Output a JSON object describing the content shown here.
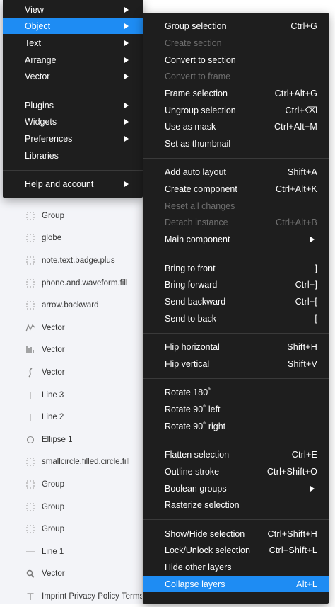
{
  "layers_panel": {
    "rows": [
      {
        "label": "Group",
        "icon": "dashed-frame-icon"
      },
      {
        "label": "globe",
        "icon": "dashed-frame-icon"
      },
      {
        "label": "note.text.badge.plus",
        "icon": "dashed-frame-icon"
      },
      {
        "label": "phone.and.waveform.fill",
        "icon": "dashed-frame-icon"
      },
      {
        "label": "arrow.backward",
        "icon": "dashed-frame-icon"
      },
      {
        "label": "Vector",
        "icon": "vector-wave-icon"
      },
      {
        "label": "Vector",
        "icon": "vector-bars-icon"
      },
      {
        "label": "Vector",
        "icon": "vector-curve-icon"
      },
      {
        "label": "Line 3",
        "icon": "vertical-line-icon"
      },
      {
        "label": "Line 2",
        "icon": "vertical-line-icon"
      },
      {
        "label": "Ellipse 1",
        "icon": "ellipse-icon"
      },
      {
        "label": "smallcircle.filled.circle.fill",
        "icon": "dashed-frame-icon"
      },
      {
        "label": "Group",
        "icon": "dashed-frame-icon"
      },
      {
        "label": "Group",
        "icon": "dashed-frame-icon"
      },
      {
        "label": "Group",
        "icon": "dashed-frame-icon"
      },
      {
        "label": "Line 1",
        "icon": "horizontal-line-icon"
      },
      {
        "label": "Vector",
        "icon": "search-icon"
      },
      {
        "label": "Imprint Privacy Policy Terms",
        "icon": "text-icon"
      }
    ]
  },
  "main_menu": {
    "items": [
      {
        "label": "View",
        "submenu": true
      },
      {
        "label": "Object",
        "submenu": true,
        "active": true
      },
      {
        "label": "Text",
        "submenu": true
      },
      {
        "label": "Arrange",
        "submenu": true
      },
      {
        "label": "Vector",
        "submenu": true
      },
      {
        "label": "Plugins",
        "submenu": true
      },
      {
        "label": "Widgets",
        "submenu": true
      },
      {
        "label": "Preferences",
        "submenu": true
      },
      {
        "label": "Libraries",
        "submenu": false
      },
      {
        "label": "Help and account",
        "submenu": true
      }
    ]
  },
  "object_menu": {
    "items": [
      {
        "label": "Group selection",
        "shortcut": "Ctrl+G"
      },
      {
        "label": "Create section",
        "shortcut": "",
        "disabled": true
      },
      {
        "label": "Convert to section",
        "shortcut": ""
      },
      {
        "label": "Convert to frame",
        "shortcut": "",
        "disabled": true
      },
      {
        "label": "Frame selection",
        "shortcut": "Ctrl+Alt+G"
      },
      {
        "label": "Ungroup selection",
        "shortcut": "Ctrl+⌫"
      },
      {
        "label": "Use as mask",
        "shortcut": "Ctrl+Alt+M"
      },
      {
        "label": "Set as thumbnail",
        "shortcut": ""
      },
      {
        "label": "Add auto layout",
        "shortcut": "Shift+A"
      },
      {
        "label": "Create component",
        "shortcut": "Ctrl+Alt+K"
      },
      {
        "label": "Reset all changes",
        "shortcut": "",
        "disabled": true
      },
      {
        "label": "Detach instance",
        "shortcut": "Ctrl+Alt+B",
        "disabled": true
      },
      {
        "label": "Main component",
        "shortcut": "",
        "submenu": true
      },
      {
        "label": "Bring to front",
        "shortcut": "]"
      },
      {
        "label": "Bring forward",
        "shortcut": "Ctrl+]"
      },
      {
        "label": "Send backward",
        "shortcut": "Ctrl+["
      },
      {
        "label": "Send to back",
        "shortcut": "["
      },
      {
        "label": "Flip horizontal",
        "shortcut": "Shift+H"
      },
      {
        "label": "Flip vertical",
        "shortcut": "Shift+V"
      },
      {
        "label": "Rotate 180˚",
        "shortcut": ""
      },
      {
        "label": "Rotate 90˚ left",
        "shortcut": ""
      },
      {
        "label": "Rotate 90˚ right",
        "shortcut": ""
      },
      {
        "label": "Flatten selection",
        "shortcut": "Ctrl+E"
      },
      {
        "label": "Outline stroke",
        "shortcut": "Ctrl+Shift+O"
      },
      {
        "label": "Boolean groups",
        "shortcut": "",
        "submenu": true
      },
      {
        "label": "Rasterize selection",
        "shortcut": ""
      },
      {
        "label": "Show/Hide selection",
        "shortcut": "Ctrl+Shift+H"
      },
      {
        "label": "Lock/Unlock selection",
        "shortcut": "Ctrl+Shift+L"
      },
      {
        "label": "Hide other layers",
        "shortcut": ""
      },
      {
        "label": "Collapse layers",
        "shortcut": "Alt+L",
        "active": true
      }
    ]
  },
  "colors": {
    "menu_bg": "#1e1e1e",
    "highlight": "#1e8cf3",
    "disabled_text": "#6f6f6f",
    "panel_bg": "#f3f4f8"
  }
}
